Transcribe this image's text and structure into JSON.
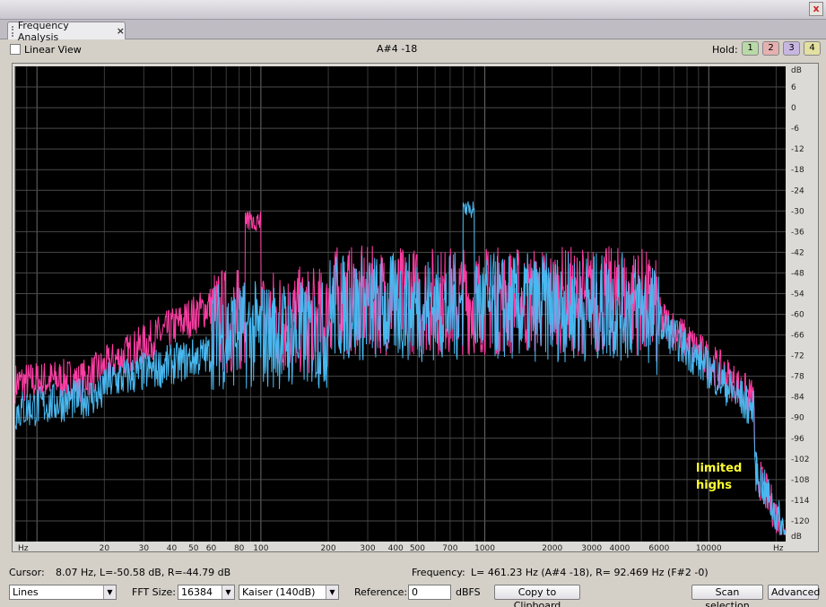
{
  "panel": {
    "tab_label": "Frequency Analysis",
    "tab_close": "×",
    "window_close": "x",
    "menu_arrow": "▶"
  },
  "options": {
    "linear_view_label": "Linear View",
    "linear_view_checked": false,
    "note_readout": "A#4 -18",
    "hold_label": "Hold:",
    "hold_buttons": [
      {
        "label": "1",
        "color": "#b9d9a6"
      },
      {
        "label": "2",
        "color": "#e6b0b0"
      },
      {
        "label": "3",
        "color": "#c7b6e0"
      },
      {
        "label": "4",
        "color": "#e3e0a2"
      }
    ]
  },
  "plot": {
    "annotation_line1": "limited",
    "annotation_line2": "highs",
    "annotation_color": "#ffff33",
    "background_color": "#000000",
    "left_channel_color": "#ff3ea5",
    "right_channel_color": "#49b8f0",
    "x_axis_unit_left": "Hz",
    "x_axis_unit_right": "Hz",
    "y_axis_unit_top": "dB",
    "y_axis_unit_bottom": "dB",
    "x_scale": "log",
    "x_tick_labels": [
      "20",
      "30",
      "40",
      "50",
      "60",
      "80",
      "100",
      "200",
      "300",
      "400",
      "500",
      "700",
      "1000",
      "2000",
      "3000",
      "4000",
      "6000",
      "10000"
    ],
    "y_tick_labels": [
      "6",
      "0",
      "-6",
      "-12",
      "-18",
      "-24",
      "-30",
      "-36",
      "-42",
      "-48",
      "-54",
      "-60",
      "-66",
      "-72",
      "-78",
      "-84",
      "-90",
      "-96",
      "-102",
      "-108",
      "-114",
      "-120"
    ]
  },
  "status": {
    "cursor_label": "Cursor:",
    "cursor_value": "8.07 Hz, L=-50.58 dB, R=-44.79 dB",
    "frequency_label": "Frequency:",
    "frequency_value": "L= 461.23 Hz (A#4 -18), R= 92.469 Hz (F#2 -0)"
  },
  "controls": {
    "display_mode": "Lines",
    "fft_label": "FFT Size:",
    "fft_size": "16384",
    "window_function": "Kaiser (140dB)",
    "reference_label": "Reference:",
    "reference_value": "0",
    "reference_unit": "dBFS",
    "copy_button": "Copy to Clipboard",
    "scan_button": "Scan selection",
    "advanced_button": "Advanced"
  }
}
